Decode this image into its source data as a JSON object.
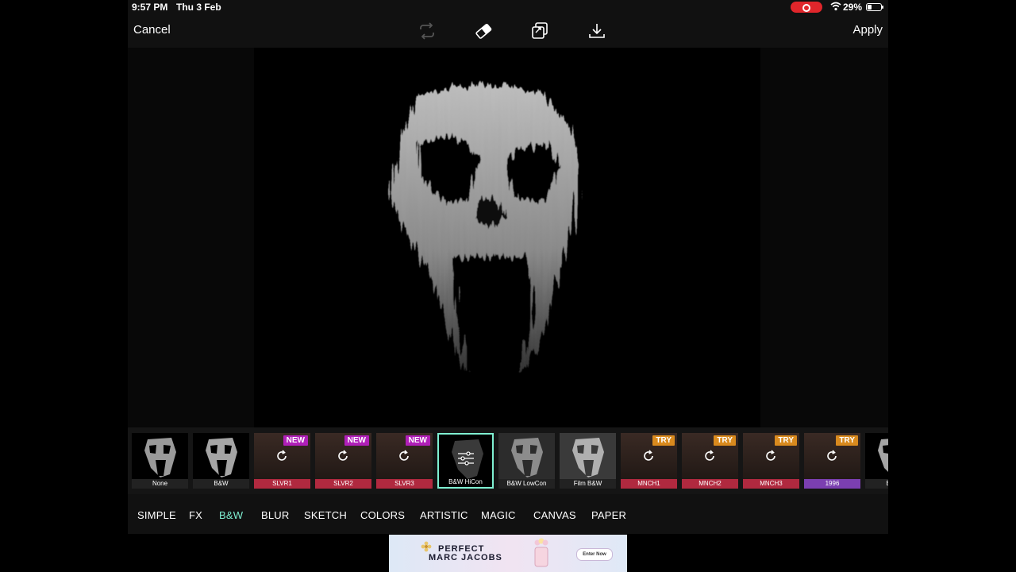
{
  "status_bar": {
    "time": "9:57 PM",
    "date": "Thu 3 Feb",
    "battery": "29%"
  },
  "toolbar": {
    "cancel_label": "Cancel",
    "apply_label": "Apply"
  },
  "filters": [
    {
      "label": "None"
    },
    {
      "label": "B&W"
    },
    {
      "label": "SLVR1",
      "badge": "NEW"
    },
    {
      "label": "SLVR2",
      "badge": "NEW"
    },
    {
      "label": "SLVR3",
      "badge": "NEW"
    },
    {
      "label": "B&W HiCon",
      "selected": true
    },
    {
      "label": "B&W LowCon"
    },
    {
      "label": "Film B&W"
    },
    {
      "label": "MNCH1",
      "badge": "TRY"
    },
    {
      "label": "MNCH2",
      "badge": "TRY"
    },
    {
      "label": "MNCH3",
      "badge": "TRY"
    },
    {
      "label": "1996",
      "badge": "TRY"
    },
    {
      "label": "B&W"
    }
  ],
  "tabs": [
    "SIMPLE",
    "FX",
    "B&W",
    "BLUR",
    "SKETCH",
    "COLORS",
    "ARTISTIC",
    "MAGIC",
    "CANVAS",
    "PAPER"
  ],
  "active_tab": "B&W",
  "ad": {
    "line1": "PERFECT",
    "line2": "MARC JACOBS",
    "cta": "Enter Now"
  },
  "colors": {
    "accent": "#7ff0d2",
    "badge_new": "#b01fb8",
    "badge_try": "#d98a1e",
    "label_slvr": "#b0293f",
    "label_mnch": "#b0293f",
    "label_1996": "#7b3fb0",
    "record": "#e0262b"
  }
}
